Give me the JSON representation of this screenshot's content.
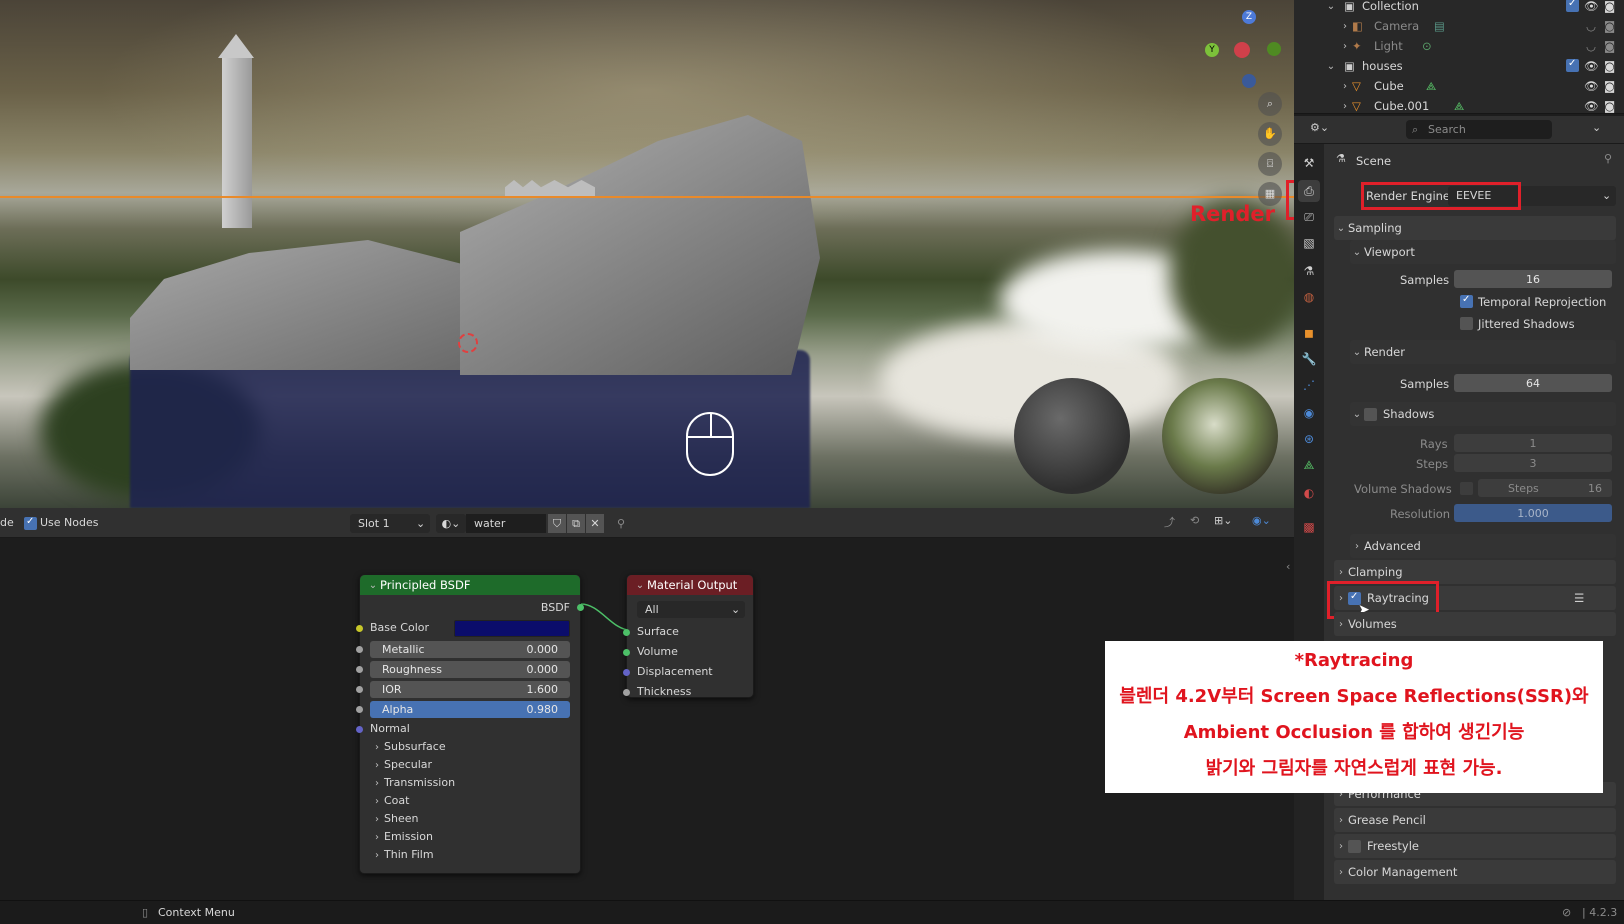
{
  "viewport": {
    "annotation_label": "Render",
    "nav_icons": [
      "zoom-icon",
      "hand-icon",
      "camera-icon",
      "grid-icon"
    ]
  },
  "outliner": {
    "rows": [
      {
        "name": "Collection",
        "type": "collection"
      },
      {
        "name": "Camera",
        "type": "object",
        "dim": true
      },
      {
        "name": "Light",
        "type": "object",
        "dim": true
      },
      {
        "name": "houses",
        "type": "collection"
      },
      {
        "name": "Cube",
        "type": "mesh"
      },
      {
        "name": "Cube.001",
        "type": "mesh"
      }
    ]
  },
  "properties": {
    "search_placeholder": "Search",
    "scene_label": "Scene",
    "render_engine_label": "Render Engine",
    "render_engine_value": "EEVEE",
    "sampling": "Sampling",
    "viewport": "Viewport",
    "samples_label": "Samples",
    "viewport_samples": "16",
    "temporal_reprojection": "Temporal Reprojection",
    "jittered_shadows": "Jittered Shadows",
    "render": "Render",
    "render_samples": "64",
    "shadows": "Shadows",
    "rays_label": "Rays",
    "rays_value": "1",
    "steps_label": "Steps",
    "steps_value": "3",
    "volume_shadows": "Volume Shadows",
    "vol_steps_label": "Steps",
    "vol_steps_value": "16",
    "resolution_label": "Resolution",
    "resolution_value": "1.000",
    "advanced": "Advanced",
    "clamping": "Clamping",
    "raytracing": "Raytracing",
    "volumes": "Volumes",
    "performance": "Performance",
    "grease_pencil": "Grease Pencil",
    "freestyle": "Freestyle",
    "color_management": "Color Management"
  },
  "node_header": {
    "mode_suffix": "de",
    "use_nodes": "Use Nodes",
    "slot": "Slot 1",
    "material": "water"
  },
  "nodes": {
    "bsdf": {
      "title": "Principled BSDF",
      "output": "BSDF",
      "base_color": "Base Color",
      "metallic_label": "Metallic",
      "metallic": "0.000",
      "roughness_label": "Roughness",
      "roughness": "0.000",
      "ior_label": "IOR",
      "ior": "1.600",
      "alpha_label": "Alpha",
      "alpha": "0.980",
      "normal": "Normal",
      "sections": [
        "Subsurface",
        "Specular",
        "Transmission",
        "Coat",
        "Sheen",
        "Emission",
        "Thin Film"
      ]
    },
    "output": {
      "title": "Material Output",
      "target": "All",
      "inputs": [
        "Surface",
        "Volume",
        "Displacement",
        "Thickness"
      ]
    }
  },
  "status": {
    "context_menu": "Context Menu",
    "version": "4.2.3"
  },
  "note": {
    "line1": "*Raytracing",
    "line2": "블렌더 4.2V부터 Screen Space Reflections(SSR)와",
    "line3": "Ambient Occlusion 를 합하여 생긴기능",
    "line4": "밝기와 그림자를 자연스럽게 표현 가능."
  },
  "colors": {
    "accent": "#4772b3",
    "highlight_red": "#e0202a",
    "bsdf_header": "#1e6b2a",
    "output_header": "#6b1e24",
    "base_color_swatch": "#0b0d6b",
    "horizon_line": "#e98a2a"
  }
}
